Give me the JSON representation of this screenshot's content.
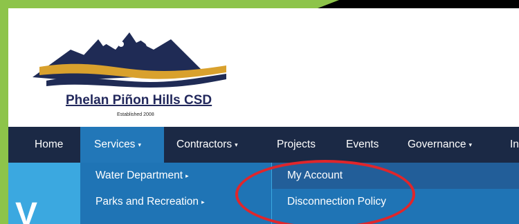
{
  "logo": {
    "name": "Phelan Piñon Hills CSD",
    "established": "Established 2008"
  },
  "nav": {
    "items": [
      {
        "label": "Home"
      },
      {
        "label": "Services",
        "has_dropdown": true,
        "active": true
      },
      {
        "label": "Contractors",
        "has_dropdown": true
      },
      {
        "label": "Projects"
      },
      {
        "label": "Events"
      },
      {
        "label": "Governance",
        "has_dropdown": true
      },
      {
        "label": "In"
      }
    ],
    "caret": "▾",
    "submenu_caret": "▸"
  },
  "dropdown": {
    "items": [
      {
        "label": "Water Department",
        "has_submenu": true
      },
      {
        "label": "Parks and Recreation",
        "has_submenu": true
      }
    ]
  },
  "submenu": {
    "items": [
      {
        "label": "My Account",
        "highlighted": true
      },
      {
        "label": "Disconnection Policy"
      }
    ]
  },
  "hero": {
    "partial_text": "V"
  },
  "annotation": {
    "type": "red-circle",
    "color": "#e0262b",
    "target": "My Account"
  },
  "colors": {
    "navbar": "#1b2945",
    "active_nav": "#2277b8",
    "dropdown": "#1f74b5",
    "highlight": "#225e99",
    "hero": "#3ba8e0",
    "logo_text": "#22285c",
    "frame_accent": "#8dc44a"
  }
}
